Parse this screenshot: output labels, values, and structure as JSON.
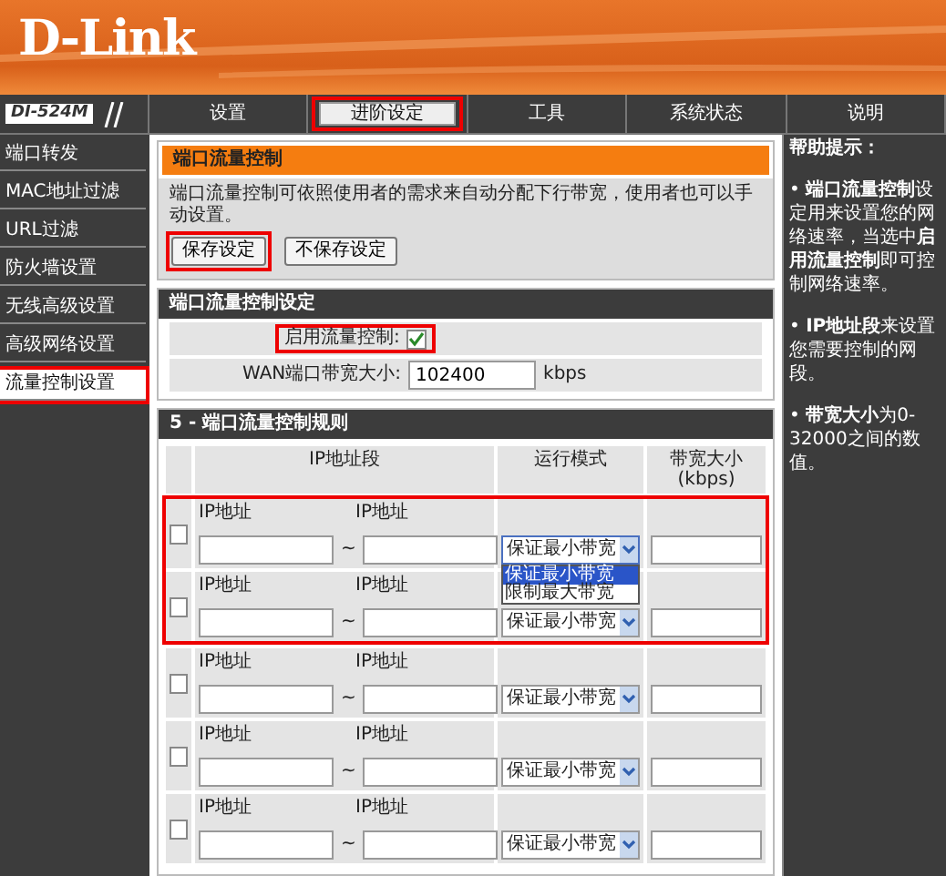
{
  "brand": {
    "logo": "D-Link",
    "model": "DI-524M"
  },
  "nav": [
    {
      "label": "设置",
      "selected": false,
      "highlighted": false
    },
    {
      "label": "进阶设定",
      "selected": true,
      "highlighted": true
    },
    {
      "label": "工具",
      "selected": false,
      "highlighted": false
    },
    {
      "label": "系统状态",
      "selected": false,
      "highlighted": false
    },
    {
      "label": "说明",
      "selected": false,
      "highlighted": false
    }
  ],
  "sidebar": {
    "items": [
      {
        "label": "端口转发",
        "selected": false,
        "highlighted": false
      },
      {
        "label": "MAC地址过滤",
        "selected": false,
        "highlighted": false
      },
      {
        "label": "URL过滤",
        "selected": false,
        "highlighted": false
      },
      {
        "label": "防火墙设置",
        "selected": false,
        "highlighted": false
      },
      {
        "label": "无线高级设置",
        "selected": false,
        "highlighted": false
      },
      {
        "label": "高级网络设置",
        "selected": false,
        "highlighted": false
      },
      {
        "label": "流量控制设置",
        "selected": true,
        "highlighted": true
      }
    ]
  },
  "intro": {
    "title": "端口流量控制",
    "text": "端口流量控制可依照使用者的需求来自动分配下行带宽，使用者也可以手动设置。",
    "buttons": [
      {
        "label": "保存设定",
        "highlighted": true
      },
      {
        "label": "不保存设定",
        "highlighted": false
      }
    ]
  },
  "settings": {
    "title": "端口流量控制设定",
    "enable": {
      "label": "启用流量控制:",
      "checked": true,
      "highlighted": true
    },
    "wan": {
      "label": "WAN端口带宽大小:",
      "value": "102400",
      "unit": "kbps"
    }
  },
  "rules": {
    "title": "5 - 端口流量控制规则",
    "columns": [
      "IP地址段",
      "运行模式",
      "带宽大小(kbps)"
    ],
    "rows": [
      {
        "checked": false,
        "highlighted": true,
        "ip_label_1": "IP地址",
        "ip_label_2": "IP地址",
        "separator": "~",
        "mode": "保证最小带宽",
        "open": true,
        "options": [
          {
            "label": "保证最小带宽",
            "selected": true
          },
          {
            "label": "限制最大带宽",
            "selected": false
          }
        ]
      },
      {
        "checked": false,
        "highlighted": true,
        "ip_label_1": "IP地址",
        "ip_label_2": "IP地址",
        "separator": "~",
        "mode": "保证最小带宽",
        "open": false
      },
      {
        "checked": false,
        "highlighted": false,
        "ip_label_1": "IP地址",
        "ip_label_2": "IP地址",
        "separator": "~",
        "mode": "保证最小带宽",
        "open": false
      },
      {
        "checked": false,
        "highlighted": false,
        "ip_label_1": "IP地址",
        "ip_label_2": "IP地址",
        "separator": "~",
        "mode": "保证最小带宽",
        "open": false
      },
      {
        "checked": false,
        "highlighted": false,
        "ip_label_1": "IP地址",
        "ip_label_2": "IP地址",
        "separator": "~",
        "mode": "保证最小带宽",
        "open": false
      }
    ]
  },
  "help": {
    "title": "帮助提示：",
    "tips": [
      "• **端口流量控制**设定用来设置您的网络速率，当选中**启用流量控制**即可控制网络速率。",
      "• **IP地址段**来设置您需要控制的网段。",
      "• **带宽大小**为0-32000之间的数值。"
    ]
  }
}
